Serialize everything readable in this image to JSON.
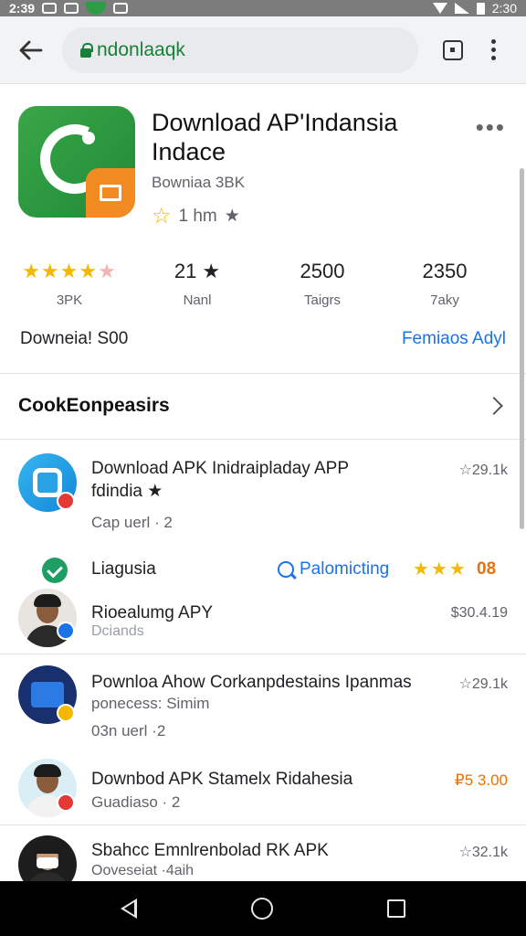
{
  "status_bar": {
    "time": "2:39",
    "right_text": "2:30"
  },
  "toolbar": {
    "url": "ndonlaaqk"
  },
  "app": {
    "title": "Download AP'Indansia Indace",
    "subtitle": "Bowniaa 3BK",
    "rating_text": "1 hm"
  },
  "stats": [
    {
      "value_stars": "★★★★",
      "value_half": "★",
      "label": "3PK"
    },
    {
      "value": "21 ★",
      "label": "Nanl"
    },
    {
      "value": "2500",
      "label": "Taigrs"
    },
    {
      "value": "2350",
      "label": "7aky"
    }
  ],
  "download_row": {
    "left": "Downeia! S00",
    "right": "Femiaos Adyl"
  },
  "section": {
    "title": "CookEonpeasirs"
  },
  "items": [
    {
      "name": "Download APK Inidraipladay APP",
      "name2": "fdindia ★",
      "sub": "Cap uerl  · 2",
      "meta": "☆29.1k"
    },
    {
      "name": "Rioealumg APY",
      "sub": "Dciands",
      "meta": "$30.4.19"
    },
    {
      "name": "Pownloa Ahow Corkanpdestains Ipanmas",
      "name2": "ponecess: Simim",
      "sub": "03n uerl  ·2",
      "meta": "☆29.1k"
    },
    {
      "name": "Downbod APK Stamelx Ridahesia",
      "sub": "Guadiaso  · 2",
      "meta": "₽5 3.00"
    },
    {
      "name": "Sbahcc Emnlrenbolad RK APK",
      "sub": "Ooveseiat  ·4aih",
      "meta": "☆32.1k"
    }
  ],
  "check_row": {
    "label": "Liagusia",
    "promo": "Palomicting",
    "stars": "★★★",
    "score": "08"
  },
  "colors": {
    "accent": "#1a73e8",
    "url_green": "#188038",
    "star": "#f5b800"
  }
}
